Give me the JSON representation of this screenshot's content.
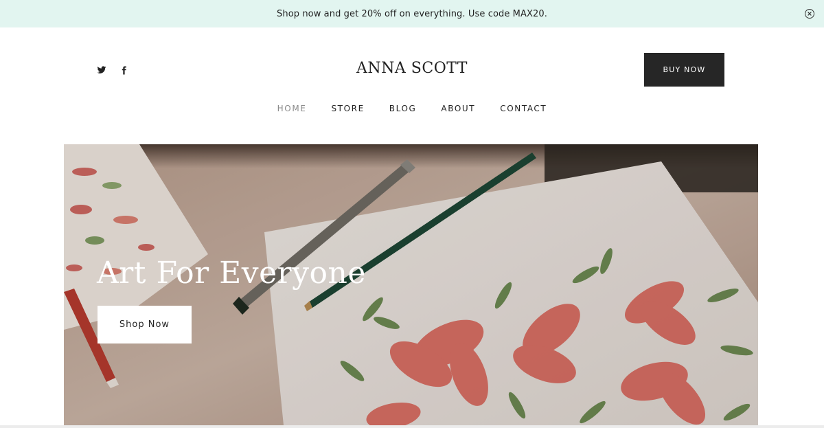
{
  "promo": {
    "text": "Shop now and get 20% off on everything. Use code MAX20.",
    "close_icon": "close-circle-icon"
  },
  "header": {
    "social_icons": [
      "twitter-icon",
      "facebook-icon"
    ],
    "brand": "ANNA SCOTT",
    "buy_button": "BUY NOW"
  },
  "nav": {
    "items": [
      {
        "label": "HOME",
        "active": true
      },
      {
        "label": "STORE",
        "active": false
      },
      {
        "label": "BLOG",
        "active": false
      },
      {
        "label": "ABOUT",
        "active": false
      },
      {
        "label": "CONTACT",
        "active": false
      }
    ]
  },
  "hero": {
    "title": "Art For Everyone",
    "button": "Shop Now"
  },
  "colors": {
    "promo_bg": "#e2f5f0",
    "button_dark": "#262626",
    "nav_active": "#8a8a8a"
  }
}
